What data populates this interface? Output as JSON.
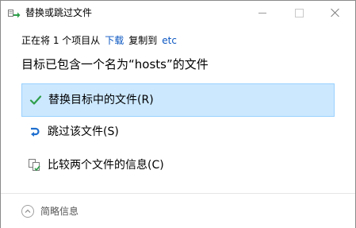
{
  "window": {
    "title": "替换或跳过文件",
    "title_icon": "file-replace-icon",
    "minimize_icon": "minimize-icon",
    "maximize_icon": "maximize-icon",
    "close_icon": "close-icon"
  },
  "copy_status": {
    "prefix": "正在将 1 个项目从",
    "source": "下载",
    "middle": "复制到",
    "destination": "etc"
  },
  "heading": "目标已包含一个名为“hosts”的文件",
  "options": {
    "replace": {
      "label": "替换目标中的文件(R)",
      "icon": "check-icon",
      "selected": true
    },
    "skip": {
      "label": "跳过该文件(S)",
      "icon": "skip-arrow-icon"
    },
    "compare": {
      "label": "比较两个文件的信息(C)",
      "icon": "compare-files-icon"
    }
  },
  "footer": {
    "fewer_details_label": "简略信息",
    "icon": "chevron-up-icon"
  },
  "colors": {
    "accent": "#0a56c2",
    "selected_bg": "#cce8ff",
    "selected_border": "#99d1ff",
    "check_green": "#2e9e4a",
    "skip_blue": "#1f6fcf"
  }
}
